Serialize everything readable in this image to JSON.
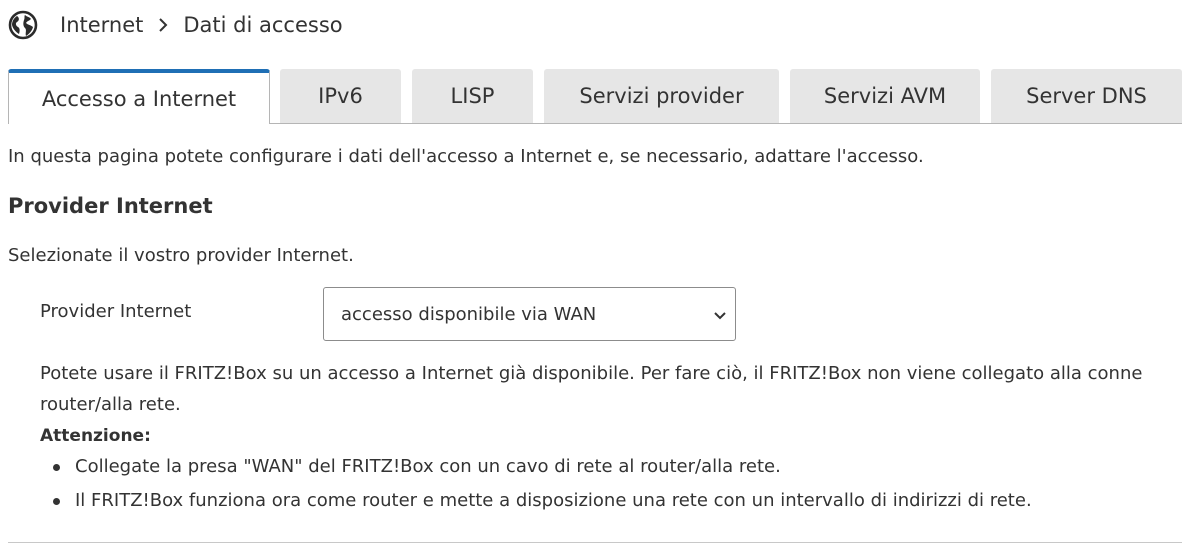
{
  "breadcrumb": {
    "icon": "globe-icon",
    "items": [
      "Internet",
      "Dati di accesso"
    ]
  },
  "tabs": [
    {
      "label": "Accesso a Internet",
      "active": true
    },
    {
      "label": "IPv6",
      "active": false
    },
    {
      "label": "LISP",
      "active": false
    },
    {
      "label": "Servizi provider",
      "active": false
    },
    {
      "label": "Servizi AVM",
      "active": false
    },
    {
      "label": "Server DNS",
      "active": false
    }
  ],
  "page": {
    "intro": "In questa pagina potete configurare i dati dell'accesso a Internet e, se necessario, adattare l'accesso.",
    "section_title": "Provider Internet",
    "select_hint": "Selezionate il vostro provider Internet.",
    "provider_label": "Provider Internet",
    "provider_value": "accesso disponibile via WAN",
    "description": "Potete usare il FRITZ!Box su un accesso a Internet già disponibile. Per fare ciò, il FRITZ!Box non viene collegato alla conne",
    "description_line2": "router/alla rete.",
    "attention_label": "Attenzione:",
    "bullets": [
      "Collegate la presa \"WAN\" del FRITZ!Box con un cavo di rete al router/alla rete.",
      "Il FRITZ!Box funziona ora come router e mette a disposizione una rete con un intervallo di indirizzi di rete."
    ]
  },
  "colors": {
    "accent": "#1f6fb5",
    "tab_inactive_bg": "#e6e6e6",
    "text": "#333333"
  }
}
